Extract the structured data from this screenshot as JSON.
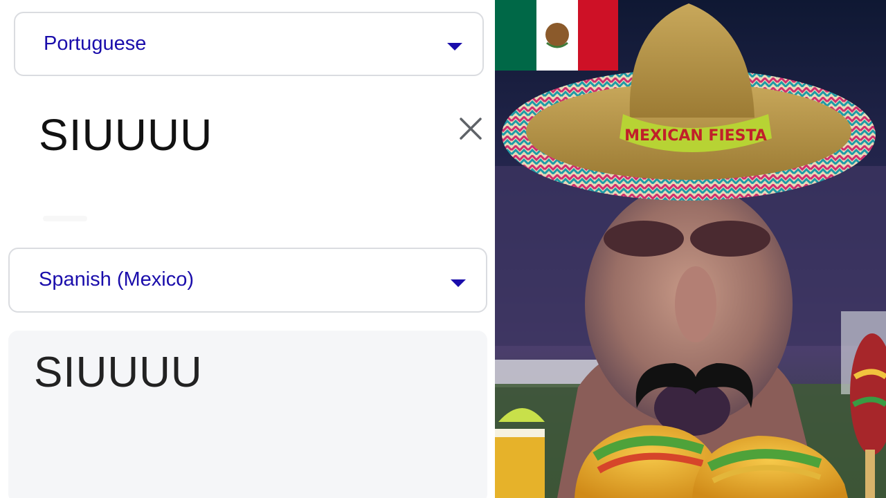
{
  "translator": {
    "source_language": "Portuguese",
    "source_text": "SIUUUU",
    "target_language": "Spanish (Mexico)",
    "translated_text": "SIUUUU"
  },
  "meme": {
    "hat_band_text": "MEXICAN FIESTA",
    "colors": {
      "flag_green": "#006847",
      "flag_white": "#ffffff",
      "flag_red": "#ce1126",
      "link_blue": "#1a0dab"
    }
  }
}
